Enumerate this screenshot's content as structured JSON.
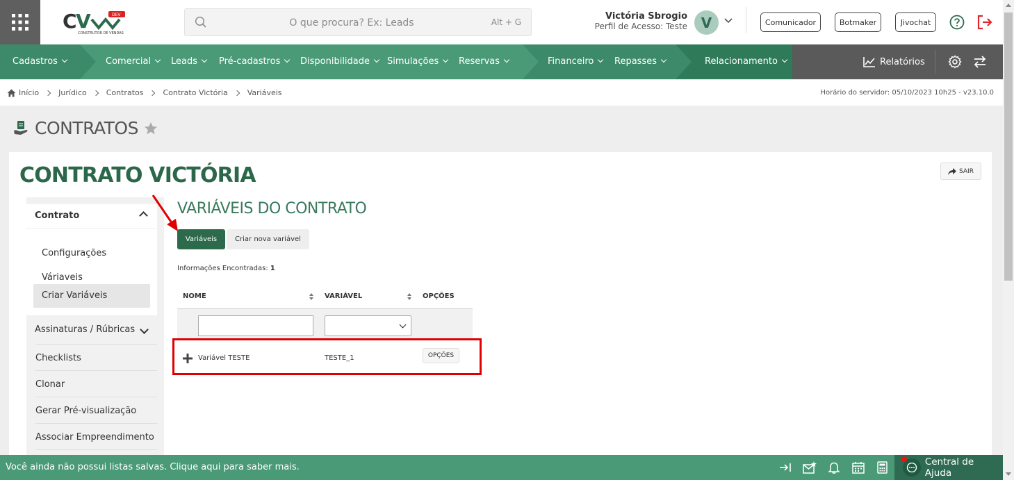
{
  "search": {
    "placeholder": "O que procura? Ex: Leads",
    "shortcut": "Alt + G"
  },
  "user": {
    "name": "Victória Sbrogio",
    "profile": "Perfil de Acesso: Teste",
    "initial": "V"
  },
  "header_buttons": {
    "comunicador": "Comunicador",
    "botmaker": "Botmaker",
    "jivochat": "Jivochat"
  },
  "nav": {
    "cadastros": "Cadastros",
    "comercial": "Comercial",
    "leads": "Leads",
    "pre_cadastros": "Pré-cadastros",
    "disponibilidade": "Disponibilidade",
    "simulacoes": "Simulações",
    "reservas": "Reservas",
    "financeiro": "Financeiro",
    "repasses": "Repasses",
    "relacionamento": "Relacionamento",
    "relatorios": "Relatórios"
  },
  "colors": {
    "nav_green": "#4a9a78",
    "dark_green": "#2d6a4c",
    "title_green": "#2b6749",
    "highlight_red": "#e00000"
  },
  "breadcrumb": [
    "Início",
    "Jurídico",
    "Contratos",
    "Contrato Victória",
    "Variáveis"
  ],
  "server_time": "Horário do servidor: 05/10/2023 10h25 - v23.10.0",
  "page_title": "CONTRATOS",
  "contract_title": "CONTRATO VICTÓRIA",
  "exit_label": "SAIR",
  "sidebar": {
    "section": "Contrato",
    "items": [
      "Configurações",
      "Váriaveis",
      "Criar Variáveis"
    ],
    "links": [
      "Assinaturas / Rúbricas",
      "Checklists",
      "Clonar",
      "Gerar Pré-visualização",
      "Associar Empreendimento"
    ]
  },
  "section_title": "VARIÁVEIS DO CONTRATO",
  "tabs": {
    "active": "Variáveis",
    "new": "Criar nova variável"
  },
  "info": {
    "label": "Informações Encontradas:",
    "count": "1"
  },
  "table": {
    "headers": {
      "name": "NOME",
      "variable": "VARIÁVEL",
      "options": "OPÇÕES"
    },
    "rows": [
      {
        "name": "Variável TESTE",
        "variable": "TESTE_1",
        "options": "OPÇÕES"
      }
    ]
  },
  "bottom": {
    "message": "Você ainda não possui listas salvas. Clique aqui para saber mais.",
    "help": "Central de Ajuda"
  }
}
